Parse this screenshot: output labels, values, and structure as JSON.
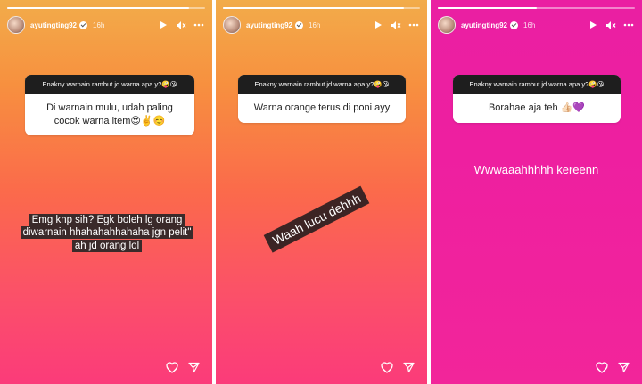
{
  "stories": [
    {
      "username": "ayutingting92",
      "time": "16h",
      "progress": 0.92,
      "question": "Enakny warnain rambut jd warna apa y?🤪😘",
      "answer": "Di warnain mulu, udah paling cocok warna item😍✌️☺️",
      "caption": "Emg knp sih? Egk boleh lg orang diwarnain hhahahahhahaha jgn pelit\" ah jd orang lol"
    },
    {
      "username": "ayutingting92",
      "time": "16h",
      "progress": 0.92,
      "question": "Enakny warnain rambut jd warna apa y?🤪😘",
      "answer": "Warna orange terus di poni ayy",
      "caption": "Waah lucu dehhh"
    },
    {
      "username": "ayutingting92",
      "time": "16h",
      "progress": 0.5,
      "question": "Enakny warnain rambut jd warna apa y?🤪😘",
      "answer": "Borahae aja teh 👍🏻💜",
      "caption": "Wwwaaahhhhh kereenn"
    }
  ],
  "icons": {
    "play": "play-icon",
    "mute": "mute-icon",
    "more": "more-icon",
    "like": "heart-icon",
    "share": "send-icon"
  }
}
